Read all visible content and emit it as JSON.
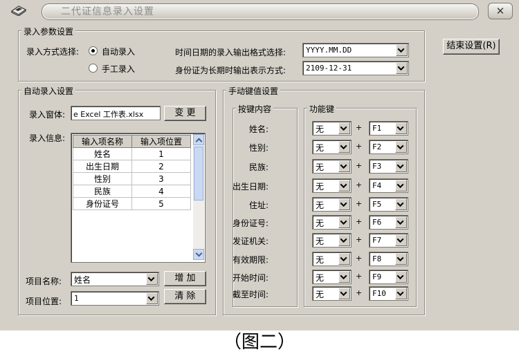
{
  "window": {
    "title": "二代证信息录入设置",
    "close_glyph": "✕",
    "end_settings_button": "结束设置(R)"
  },
  "entry_params": {
    "title": "录入参数设置",
    "mode_label": "录入方式选择:",
    "mode_auto": "自动录入",
    "mode_manual": "手工录入",
    "selected_mode": "auto",
    "date_format_label": "时间日期的录入输出格式选择:",
    "date_format_value": "YYYY.MM.DD",
    "long_term_label": "身份证为长期时输出表示方式:",
    "long_term_value": "2109-12-31"
  },
  "auto_entry": {
    "title": "自动录入设置",
    "form_label": "录入窗体:",
    "form_value": "e Excel 工作表.xlsx",
    "change_button": "变 更",
    "info_label": "录入信息:",
    "table_headers": [
      "输入项名称",
      "输入项位置"
    ],
    "rows": [
      {
        "name": "姓名",
        "pos": "1"
      },
      {
        "name": "出生日期",
        "pos": "2"
      },
      {
        "name": "性别",
        "pos": "3"
      },
      {
        "name": "民族",
        "pos": "4"
      },
      {
        "name": "身份证号",
        "pos": "5"
      }
    ],
    "item_name_label": "项目名称:",
    "item_name_value": "姓名",
    "item_pos_label": "项目位置:",
    "item_pos_value": "1",
    "add_button": "增 加",
    "clear_button": "清 除"
  },
  "manual_keys": {
    "title": "手动键值设置",
    "content_title": "按键内容",
    "fn_title": "功能键",
    "plus": "+",
    "keys": [
      {
        "label": "姓名:",
        "modifier": "无",
        "key": "F1"
      },
      {
        "label": "性别:",
        "modifier": "无",
        "key": "F2"
      },
      {
        "label": "民族:",
        "modifier": "无",
        "key": "F3"
      },
      {
        "label": "出生日期:",
        "modifier": "无",
        "key": "F4"
      },
      {
        "label": "住址:",
        "modifier": "无",
        "key": "F5"
      },
      {
        "label": "身份证号:",
        "modifier": "无",
        "key": "F6"
      },
      {
        "label": "发证机关:",
        "modifier": "无",
        "key": "F7"
      },
      {
        "label": "有效期限:",
        "modifier": "无",
        "key": "F8"
      },
      {
        "label": "开始时间:",
        "modifier": "无",
        "key": "F9"
      },
      {
        "label": "截至时间:",
        "modifier": "无",
        "key": "F10"
      }
    ]
  },
  "caption": "（图二）"
}
